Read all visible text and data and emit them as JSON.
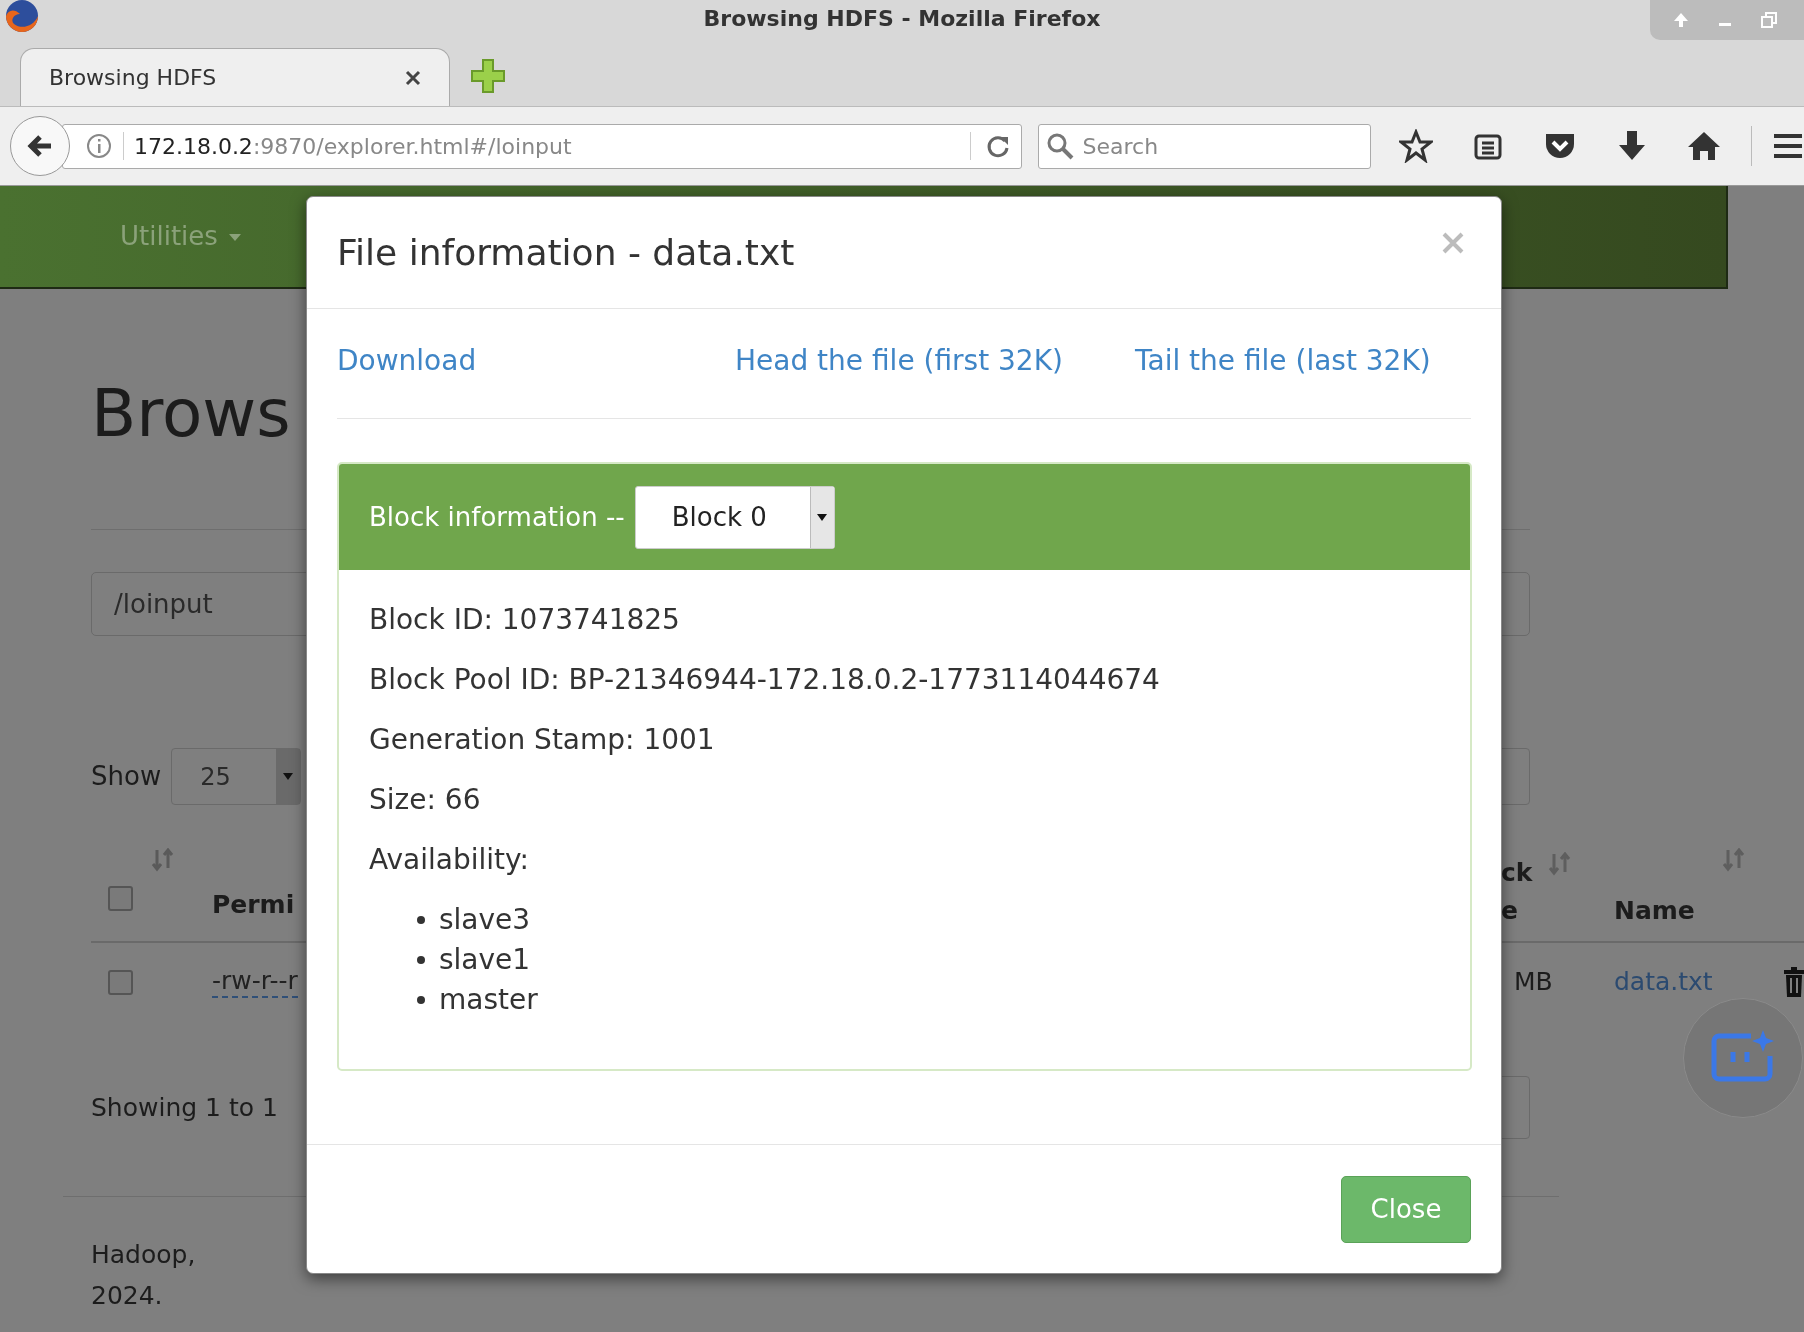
{
  "window": {
    "title": "Browsing HDFS - Mozilla Firefox"
  },
  "tabs": [
    {
      "label": "Browsing HDFS",
      "selected": true
    }
  ],
  "address_bar": {
    "host": "172.18.0.2",
    "path": ":9870/explorer.html#/loinput"
  },
  "search": {
    "placeholder": "Search"
  },
  "page": {
    "nav_menu": "Utilities",
    "heading": "Brows",
    "path_field": "/loinput",
    "show_label": "Show",
    "page_size": "25",
    "table": {
      "select_all_checked": false,
      "columns": [
        {
          "lines": [
            "Permi"
          ]
        },
        {
          "lines": [
            "ck",
            "e"
          ]
        },
        {
          "lines": [
            "Name"
          ]
        }
      ],
      "rows": [
        {
          "checked": false,
          "cells": [
            "-rw-r--r",
            "MB",
            "data.txt"
          ]
        }
      ]
    },
    "info": "Showing 1 to 1",
    "footer": "Hadoop, 2024."
  },
  "modal": {
    "title": "File information - data.txt",
    "links": [
      "Download",
      "Head the file (first 32K)",
      "Tail the file (last 32K)"
    ],
    "block_panel": {
      "label": "Block information --",
      "selected_block": "Block 0",
      "fields": [
        "Block ID: 1073741825",
        "Block Pool ID: BP-21346944-172.18.0.2-1773114044674",
        "Generation Stamp: 1001",
        "Size: 66"
      ],
      "availability_label": "Availability:",
      "hosts": [
        "slave3",
        "slave1",
        "master"
      ]
    },
    "close_button": "Close"
  }
}
